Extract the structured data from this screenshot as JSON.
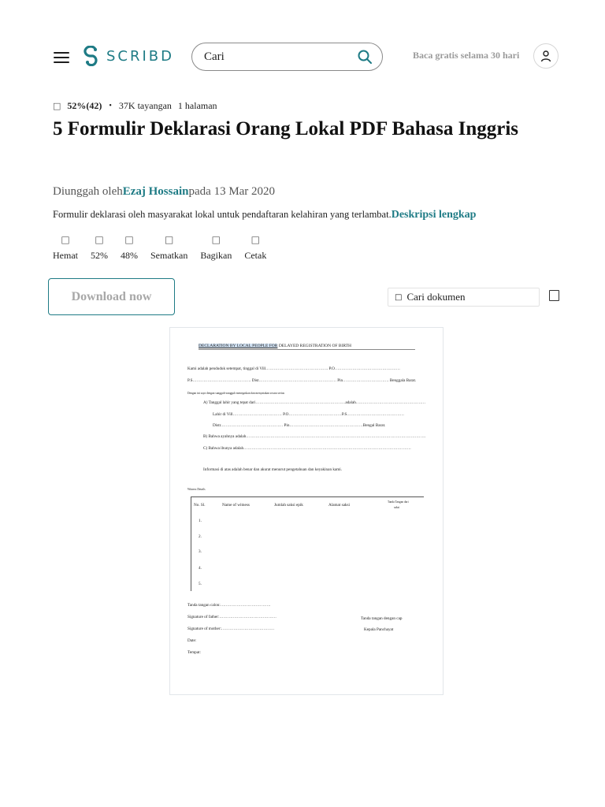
{
  "header": {
    "logo_text": "SCRIBD",
    "search_placeholder": "Cari",
    "trial_text": "Baca gratis selama 30 hari",
    "brand_color": "#1e7b85"
  },
  "meta": {
    "rating_icon": "thumbs-up-icon",
    "rating": "52%(42)",
    "views": "37K tayangan",
    "pages": "1 halaman"
  },
  "title": "5 Formulir Deklarasi Orang Lokal PDF Bahasa Inggris",
  "uploader": {
    "prefix": "Diunggah oleh",
    "name": "Ezaj Hossain",
    "suffix": "pada 13 Mar 2020"
  },
  "description": {
    "text": "Formulir deklarasi oleh masyarakat lokal untuk pendaftaran kelahiran yang terlambat.",
    "link": "Deskripsi lengkap"
  },
  "actions": [
    {
      "label": "Hemat",
      "icon": "bookmark-icon"
    },
    {
      "label": "52%",
      "icon": "thumbs-up-icon"
    },
    {
      "label": "48%",
      "icon": "thumbs-down-icon"
    },
    {
      "label": "Sematkan",
      "icon": "embed-icon"
    },
    {
      "label": "Bagikan",
      "icon": "share-icon"
    },
    {
      "label": "Cetak",
      "icon": "print-icon"
    }
  ],
  "download_label": "Download now",
  "doc_search_label": "Cari dokumen",
  "document": {
    "heading_highlight": "DECLARATION BY LOCAL PEOPLE FOR",
    "heading_rest": " DELAYED REGISTRATION OF BIRTH",
    "line1": "Kami adalah penduduk setempat, tinggal di Vill………………………………………. P.O…………………………………………",
    "line2": "P.S……………………………………. Dist………………………………………………… Pin……………………………. Benggala Barat.",
    "line3": "Dengan ini saya dengan sungguh-sungguh menegaskan dan menyatakan secara serius",
    "itemA1": "A)  Tanggal  lahir  yang  tepat  dari…………………………………………………………adalah……………………………………………",
    "itemA2": "Lahir di Vill……………………………… P.O…………………………………P.S……………………………………",
    "itemA3": "Distr.……………………………………… Pin………………………………………………Bengal Barat.",
    "itemB": "B)  Bahwa  ayahnya  adalah……………………………………………………………………………………………………………………",
    "itemC": "C)  Bahwa  ibunya  adalah……………………………………………………………………………………………………………",
    "info": "Informasi di atas adalah benar dan akurat menurut pengetahuan dan keyakinan kami.",
    "witness_label": "Witness Details",
    "table_headers": [
      "No. Sl.",
      "Name of witness",
      "Jumlah saksi epik",
      "Alamat saksi",
      "Tanda Tangan dari",
      "saksi"
    ],
    "rows": [
      "1.",
      "2.",
      "3.",
      "4.",
      "5."
    ],
    "sig_candidate": "Tanda tangan calon:……………………………….",
    "sig_father": "Signature of father:……………………………………",
    "sig_mother": "Signature of mother:…………………………………",
    "date": "Date:",
    "place": "Tempat:",
    "stamp_1": "Tanda tangan dengan cap",
    "stamp_2": "Kepala Panchayat"
  }
}
